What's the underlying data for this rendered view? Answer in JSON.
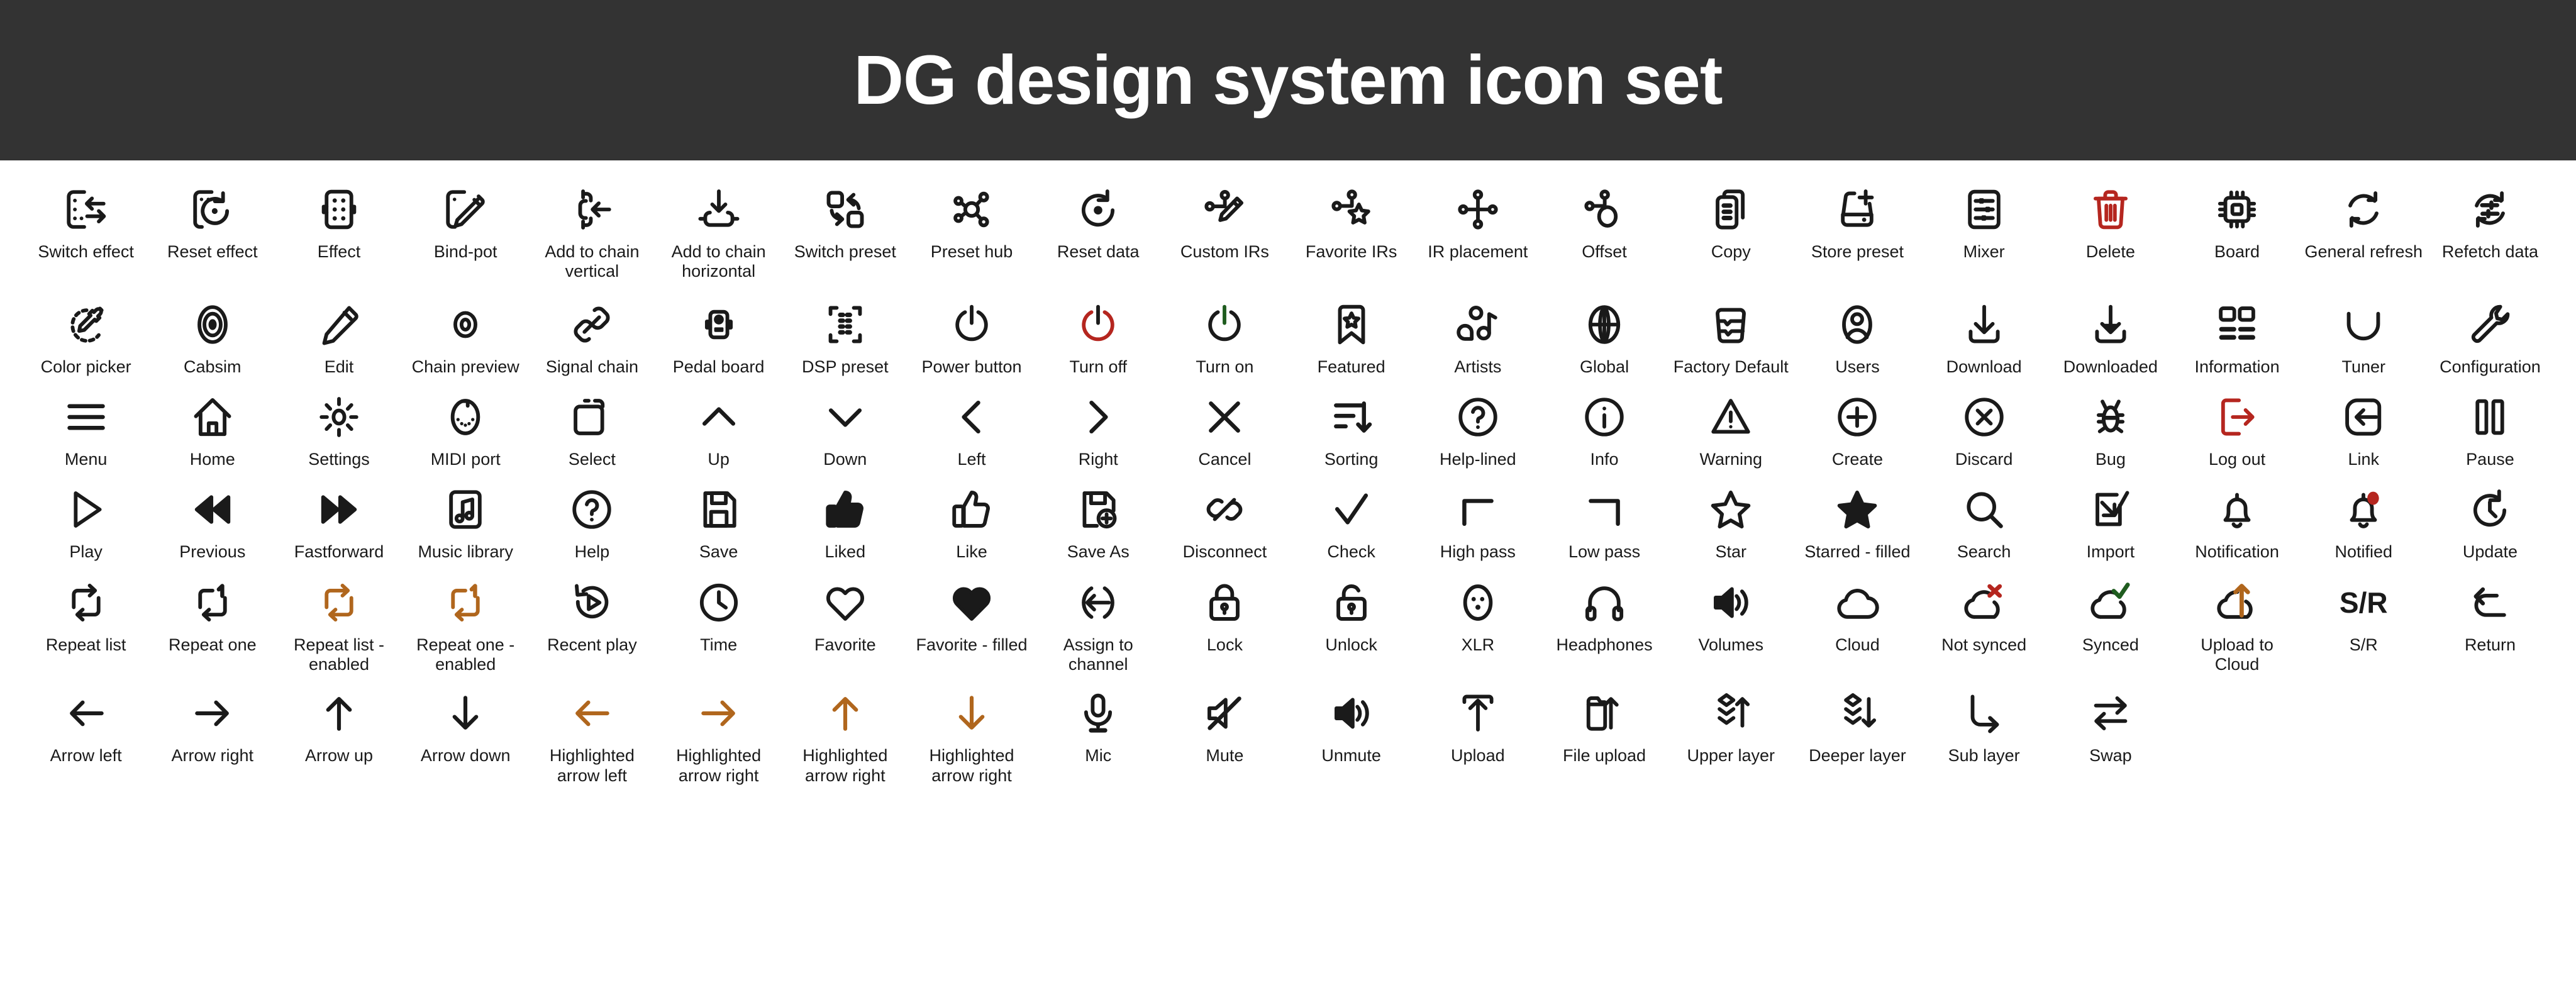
{
  "header": {
    "title": "DG design system icon set",
    "background": "#333333",
    "text_color": "#ffffff"
  },
  "colors": {
    "default": "#1a1a1a",
    "danger": "#b5261f",
    "accent_orange": "#b0661d",
    "success_green": "#1f5c1f"
  },
  "rows": [
    {
      "id": "row-1",
      "icons": [
        {
          "label": "Switch effect",
          "icon": "switch-effect-icon",
          "color": "default"
        },
        {
          "label": "Reset effect",
          "icon": "reset-effect-icon",
          "color": "default"
        },
        {
          "label": "Effect",
          "icon": "effect-icon",
          "color": "default"
        },
        {
          "label": "Bind-pot",
          "icon": "bind-pot-icon",
          "color": "default"
        },
        {
          "label": "Add to chain vertical",
          "icon": "add-to-chain-vertical-icon",
          "color": "default"
        },
        {
          "label": "Add to chain horizontal",
          "icon": "add-to-chain-horizontal-icon",
          "color": "default"
        },
        {
          "label": "Switch preset",
          "icon": "switch-preset-icon",
          "color": "default"
        },
        {
          "label": "Preset hub",
          "icon": "preset-hub-icon",
          "color": "default"
        },
        {
          "label": "Reset data",
          "icon": "reset-data-icon",
          "color": "default"
        },
        {
          "label": "Custom IRs",
          "icon": "custom-irs-icon",
          "color": "default"
        },
        {
          "label": "Favorite IRs",
          "icon": "favorite-irs-icon",
          "color": "default"
        },
        {
          "label": "IR placement",
          "icon": "ir-placement-icon",
          "color": "default"
        },
        {
          "label": "Offset",
          "icon": "offset-icon",
          "color": "default"
        },
        {
          "label": "Copy",
          "icon": "copy-icon",
          "color": "default"
        },
        {
          "label": "Store preset",
          "icon": "store-preset-icon",
          "color": "default"
        },
        {
          "label": "Mixer",
          "icon": "mixer-icon",
          "color": "default"
        },
        {
          "label": "Delete",
          "icon": "trash-icon",
          "color": "danger"
        },
        {
          "label": "Board",
          "icon": "board-chip-icon",
          "color": "default"
        },
        {
          "label": "General refresh",
          "icon": "general-refresh-icon",
          "color": "default"
        },
        {
          "label": "Refetch data",
          "icon": "refetch-data-icon",
          "color": "default"
        }
      ]
    },
    {
      "id": "row-2",
      "icons": [
        {
          "label": "Color picker",
          "icon": "color-picker-icon",
          "color": "default"
        },
        {
          "label": "Cabsim",
          "icon": "cabsim-icon",
          "color": "default"
        },
        {
          "label": "Edit",
          "icon": "pencil-icon",
          "color": "default"
        },
        {
          "label": "Chain preview",
          "icon": "eye-icon",
          "color": "default"
        },
        {
          "label": "Signal chain",
          "icon": "signal-chain-icon",
          "color": "default"
        },
        {
          "label": "Pedal board",
          "icon": "pedal-board-icon",
          "color": "default"
        },
        {
          "label": "DSP preset",
          "icon": "dsp-preset-icon",
          "color": "default"
        },
        {
          "label": "Power button",
          "icon": "power-icon",
          "color": "default"
        },
        {
          "label": "Turn off",
          "icon": "turn-off-icon",
          "color": "danger"
        },
        {
          "label": "Turn on",
          "icon": "turn-on-icon",
          "color": "default"
        },
        {
          "label": "Featured",
          "icon": "featured-bookmark-icon",
          "color": "default"
        },
        {
          "label": "Artists",
          "icon": "artists-icon",
          "color": "default"
        },
        {
          "label": "Global",
          "icon": "globe-icon",
          "color": "default"
        },
        {
          "label": "Factory Default",
          "icon": "factory-default-icon",
          "color": "default"
        },
        {
          "label": "Users",
          "icon": "user-icon",
          "color": "default"
        },
        {
          "label": "Download",
          "icon": "download-icon",
          "color": "default"
        },
        {
          "label": "Downloaded",
          "icon": "downloaded-icon",
          "color": "default"
        },
        {
          "label": "Information",
          "icon": "information-grid-icon",
          "color": "default"
        },
        {
          "label": "Tuner",
          "icon": "tuner-icon",
          "color": "default"
        },
        {
          "label": "Configuration",
          "icon": "wrench-icon",
          "color": "default"
        }
      ]
    },
    {
      "id": "row-3",
      "icons": [
        {
          "label": "Menu",
          "icon": "hamburger-menu-icon",
          "color": "default"
        },
        {
          "label": "Home",
          "icon": "home-icon",
          "color": "default"
        },
        {
          "label": "Settings",
          "icon": "gear-icon",
          "color": "default"
        },
        {
          "label": "MIDI port",
          "icon": "midi-port-icon",
          "color": "default"
        },
        {
          "label": "Select",
          "icon": "select-icon",
          "color": "default"
        },
        {
          "label": "Up",
          "icon": "chevron-up-icon",
          "color": "default"
        },
        {
          "label": "Down",
          "icon": "chevron-down-icon",
          "color": "default"
        },
        {
          "label": "Left",
          "icon": "chevron-left-icon",
          "color": "default"
        },
        {
          "label": "Right",
          "icon": "chevron-right-icon",
          "color": "default"
        },
        {
          "label": "Cancel",
          "icon": "close-x-icon",
          "color": "default"
        },
        {
          "label": "Sorting",
          "icon": "sorting-icon",
          "color": "default"
        },
        {
          "label": "Help-lined",
          "icon": "help-lined-icon",
          "color": "default"
        },
        {
          "label": "Info",
          "icon": "info-icon",
          "color": "default"
        },
        {
          "label": "Warning",
          "icon": "warning-icon",
          "color": "default"
        },
        {
          "label": "Create",
          "icon": "plus-circle-icon",
          "color": "default"
        },
        {
          "label": "Discard",
          "icon": "discard-icon",
          "color": "default"
        },
        {
          "label": "Bug",
          "icon": "bug-icon",
          "color": "default"
        },
        {
          "label": "Log out",
          "icon": "log-out-icon",
          "color": "danger"
        },
        {
          "label": "Link",
          "icon": "link-in-icon",
          "color": "default"
        },
        {
          "label": "Pause",
          "icon": "pause-icon",
          "color": "default"
        }
      ]
    },
    {
      "id": "row-4",
      "icons": [
        {
          "label": "Play",
          "icon": "play-icon",
          "color": "default"
        },
        {
          "label": "Previous",
          "icon": "previous-icon",
          "color": "default"
        },
        {
          "label": "Fastforward",
          "icon": "fastforward-icon",
          "color": "default"
        },
        {
          "label": "Music library",
          "icon": "music-library-icon",
          "color": "default"
        },
        {
          "label": "Help",
          "icon": "help-icon",
          "color": "default"
        },
        {
          "label": "Save",
          "icon": "save-icon",
          "color": "default"
        },
        {
          "label": "Liked",
          "icon": "thumbs-up-filled-icon",
          "color": "default"
        },
        {
          "label": "Like",
          "icon": "thumbs-up-icon",
          "color": "default"
        },
        {
          "label": "Save As",
          "icon": "save-as-icon",
          "color": "default"
        },
        {
          "label": "Disconnect",
          "icon": "disconnect-icon",
          "color": "default"
        },
        {
          "label": "Check",
          "icon": "check-icon",
          "color": "default"
        },
        {
          "label": "High pass",
          "icon": "high-pass-icon",
          "color": "default"
        },
        {
          "label": "Low pass",
          "icon": "low-pass-icon",
          "color": "default"
        },
        {
          "label": "Star",
          "icon": "star-icon",
          "color": "default"
        },
        {
          "label": "Starred - filled",
          "icon": "star-filled-icon",
          "color": "default"
        },
        {
          "label": "Search",
          "icon": "search-icon",
          "color": "default"
        },
        {
          "label": "Import",
          "icon": "import-icon",
          "color": "default"
        },
        {
          "label": "Notification",
          "icon": "bell-icon",
          "color": "default"
        },
        {
          "label": "Notified",
          "icon": "bell-notified-icon",
          "color": "default"
        },
        {
          "label": "Update",
          "icon": "update-icon",
          "color": "default"
        }
      ]
    },
    {
      "id": "row-5",
      "icons": [
        {
          "label": "Repeat list",
          "icon": "repeat-list-icon",
          "color": "default"
        },
        {
          "label": "Repeat one",
          "icon": "repeat-one-icon",
          "color": "default"
        },
        {
          "label": "Repeat list - enabled",
          "icon": "repeat-list-enabled-icon",
          "color": "accent_orange"
        },
        {
          "label": "Repeat one - enabled",
          "icon": "repeat-one-enabled-icon",
          "color": "accent_orange"
        },
        {
          "label": "Recent play",
          "icon": "recent-play-icon",
          "color": "default"
        },
        {
          "label": "Time",
          "icon": "clock-icon",
          "color": "default"
        },
        {
          "label": "Favorite",
          "icon": "heart-icon",
          "color": "default"
        },
        {
          "label": "Favorite - filled",
          "icon": "heart-filled-icon",
          "color": "default"
        },
        {
          "label": "Assign to channel",
          "icon": "assign-to-channel-icon",
          "color": "default"
        },
        {
          "label": "Lock",
          "icon": "lock-icon",
          "color": "default"
        },
        {
          "label": "Unlock",
          "icon": "unlock-icon",
          "color": "default"
        },
        {
          "label": "XLR",
          "icon": "xlr-icon",
          "color": "default"
        },
        {
          "label": "Headphones",
          "icon": "headphones-icon",
          "color": "default"
        },
        {
          "label": "Volumes",
          "icon": "volumes-icon",
          "color": "default"
        },
        {
          "label": "Cloud",
          "icon": "cloud-icon",
          "color": "default"
        },
        {
          "label": "Not synced",
          "icon": "not-synced-icon",
          "color": "default"
        },
        {
          "label": "Synced",
          "icon": "synced-icon",
          "color": "default"
        },
        {
          "label": "Upload to Cloud",
          "icon": "upload-to-cloud-icon",
          "color": "default"
        },
        {
          "label": "S/R",
          "icon": "sr-text-icon",
          "color": "default"
        },
        {
          "label": "Return",
          "icon": "return-icon",
          "color": "default"
        }
      ]
    },
    {
      "id": "row-6",
      "icons": [
        {
          "label": "Arrow left",
          "icon": "arrow-left-icon",
          "color": "default"
        },
        {
          "label": "Arrow right",
          "icon": "arrow-right-icon",
          "color": "default"
        },
        {
          "label": "Arrow up",
          "icon": "arrow-up-icon",
          "color": "default"
        },
        {
          "label": "Arrow down",
          "icon": "arrow-down-icon",
          "color": "default"
        },
        {
          "label": "Highlighted arrow left",
          "icon": "highlighted-arrow-left-icon",
          "color": "accent_orange"
        },
        {
          "label": "Highlighted arrow right",
          "icon": "highlighted-arrow-right-icon",
          "color": "accent_orange"
        },
        {
          "label": "Highlighted arrow right",
          "icon": "highlighted-arrow-up-icon",
          "color": "accent_orange"
        },
        {
          "label": "Highlighted arrow right",
          "icon": "highlighted-arrow-down-icon",
          "color": "accent_orange"
        },
        {
          "label": "Mic",
          "icon": "mic-icon",
          "color": "default"
        },
        {
          "label": "Mute",
          "icon": "mute-icon",
          "color": "default"
        },
        {
          "label": "Unmute",
          "icon": "unmute-icon",
          "color": "default"
        },
        {
          "label": "Upload",
          "icon": "upload-icon",
          "color": "default"
        },
        {
          "label": "File upload",
          "icon": "file-upload-icon",
          "color": "default"
        },
        {
          "label": "Upper layer",
          "icon": "upper-layer-icon",
          "color": "default"
        },
        {
          "label": "Deeper layer",
          "icon": "deeper-layer-icon",
          "color": "default"
        },
        {
          "label": "Sub layer",
          "icon": "sub-layer-icon",
          "color": "default"
        },
        {
          "label": "Swap",
          "icon": "swap-icon",
          "color": "default"
        }
      ]
    }
  ]
}
